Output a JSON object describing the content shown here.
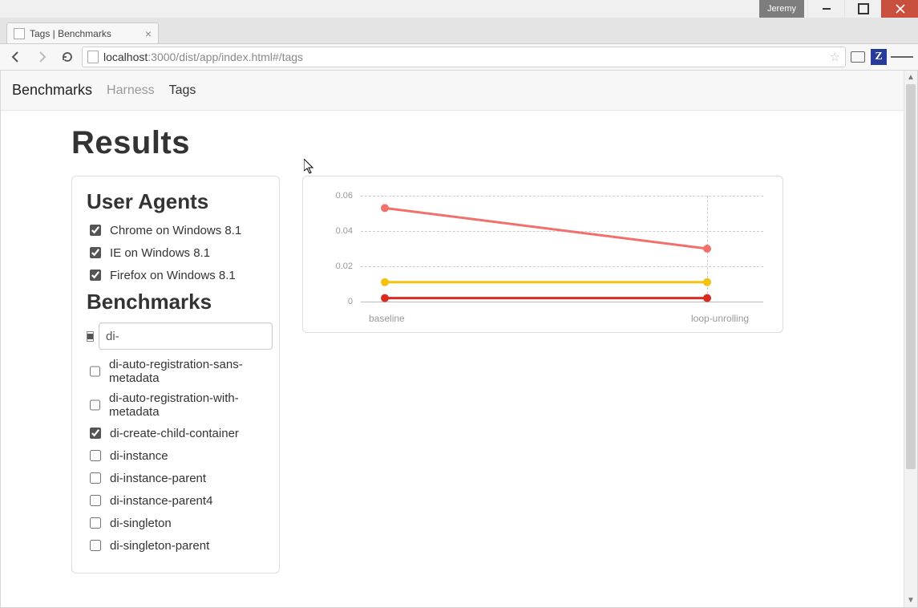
{
  "window": {
    "user": "Jeremy"
  },
  "browser": {
    "tab_title": "Tags | Benchmarks",
    "url_host": "localhost",
    "url_port_path": ":3000/dist/app/index.html#/tags",
    "ext_letter": "Z"
  },
  "nav": {
    "brand": "Benchmarks",
    "links": [
      {
        "label": "Harness",
        "active": false
      },
      {
        "label": "Tags",
        "active": true
      }
    ]
  },
  "page_title": "Results",
  "sidebar": {
    "ua_heading": "User Agents",
    "user_agents": [
      {
        "label": "Chrome on Windows 8.1",
        "checked": true
      },
      {
        "label": "IE on Windows 8.1",
        "checked": true
      },
      {
        "label": "Firefox on Windows 8.1",
        "checked": true
      }
    ],
    "bench_heading": "Benchmarks",
    "filter_value": "di-",
    "benchmarks": [
      {
        "label": "di-auto-registration-sans-metadata",
        "checked": false
      },
      {
        "label": "di-auto-registration-with-metadata",
        "checked": false
      },
      {
        "label": "di-create-child-container",
        "checked": true
      },
      {
        "label": "di-instance",
        "checked": false
      },
      {
        "label": "di-instance-parent",
        "checked": false
      },
      {
        "label": "di-instance-parent4",
        "checked": false
      },
      {
        "label": "di-singleton",
        "checked": false
      },
      {
        "label": "di-singleton-parent",
        "checked": false
      }
    ]
  },
  "chart_data": {
    "type": "line",
    "x": [
      "baseline",
      "loop-unrolling"
    ],
    "ylabel": "",
    "ylim": [
      0,
      0.06
    ],
    "yticks": [
      0,
      0.02,
      0.04,
      0.06
    ],
    "series": [
      {
        "name": "Chrome on Windows 8.1",
        "color": "#f1706c",
        "values": [
          0.053,
          0.03
        ]
      },
      {
        "name": "IE on Windows 8.1",
        "color": "#f4c20d",
        "values": [
          0.011,
          0.011
        ]
      },
      {
        "name": "Firefox on Windows 8.1",
        "color": "#db2b20",
        "values": [
          0.002,
          0.002
        ]
      }
    ]
  }
}
